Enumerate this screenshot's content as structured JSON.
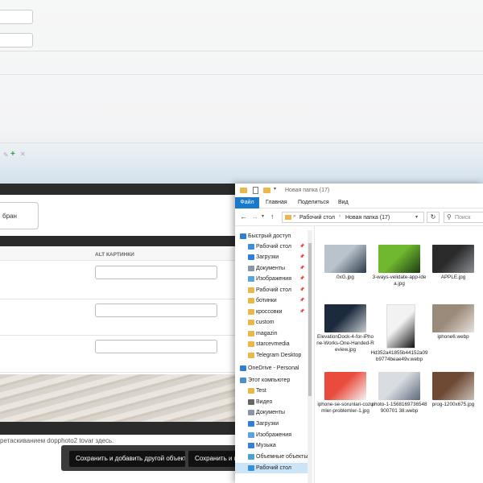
{
  "admin": {
    "choice_tail": "бран",
    "table_header_alt": "ALT КАРТИНКИ",
    "drag_hint": "ретаскиванием dopphoto2 tovar здесь.",
    "save_add_label": "Сохранить и добавить другой объект",
    "save_continue_label": "Сохранить и п",
    "icons": [
      "pencil-icon",
      "plus-icon",
      "close-icon"
    ],
    "colors": {
      "dark_bar": "#2b2b2b",
      "button": "#111111",
      "add_icon": "#2a9d3c"
    }
  },
  "explorer": {
    "title": "Новая папка (17)",
    "ribbon_tabs": [
      "Файл",
      "Главная",
      "Поделиться",
      "Вид"
    ],
    "breadcrumb": [
      "Рабочий стол",
      "Новая папка (17)"
    ],
    "search_placeholder": "Поиск",
    "nav": [
      {
        "label": "Быстрый доступ",
        "icon": "star-icon",
        "pinned": false
      },
      {
        "label": "Рабочий стол",
        "icon": "desktop-icon",
        "pinned": true
      },
      {
        "label": "Загрузки",
        "icon": "download-icon",
        "pinned": true
      },
      {
        "label": "Документы",
        "icon": "documents-icon",
        "pinned": true
      },
      {
        "label": "Изображения",
        "icon": "pictures-icon",
        "pinned": true
      },
      {
        "label": "Рабочий стол",
        "icon": "folder-icon",
        "pinned": true
      },
      {
        "label": "ботинки",
        "icon": "folder-icon",
        "pinned": true
      },
      {
        "label": "кроссовки",
        "icon": "folder-icon",
        "pinned": true
      },
      {
        "label": "custom",
        "icon": "folder-icon",
        "pinned": false
      },
      {
        "label": "magazin",
        "icon": "folder-icon",
        "pinned": false
      },
      {
        "label": "starcevmedia",
        "icon": "folder-icon",
        "pinned": false
      },
      {
        "label": "Telegram Desktop",
        "icon": "folder-icon",
        "pinned": false
      },
      {
        "label": "OneDrive - Personal",
        "icon": "cloud-icon",
        "pinned": false
      },
      {
        "label": "Этот компьютер",
        "icon": "computer-icon",
        "pinned": false
      },
      {
        "label": "Test",
        "icon": "folder-icon",
        "pinned": false
      },
      {
        "label": "Видео",
        "icon": "video-icon",
        "pinned": false
      },
      {
        "label": "Документы",
        "icon": "documents-icon",
        "pinned": false
      },
      {
        "label": "Загрузки",
        "icon": "download-icon",
        "pinned": false
      },
      {
        "label": "Изображения",
        "icon": "pictures-icon",
        "pinned": false
      },
      {
        "label": "Музыка",
        "icon": "music-icon",
        "pinned": false
      },
      {
        "label": "Объемные объекты",
        "icon": "3d-objects-icon",
        "pinned": false
      },
      {
        "label": "Рабочий стол",
        "icon": "desktop-icon",
        "pinned": false
      }
    ],
    "files": [
      {
        "name": "0xG.jpg",
        "colors": [
          "#b9c3cc",
          "#2b3a4a"
        ]
      },
      {
        "name": "3-ways-velidate-app-idea.jpg",
        "colors": [
          "#6fb82f",
          "#1d3a12"
        ]
      },
      {
        "name": "APPLE.jpg",
        "colors": [
          "#2a2a2a",
          "#8a8f94"
        ]
      },
      {
        "name": "ElevationDock-4-for-iPhone-Works-One-Handed-Review.jpg",
        "colors": [
          "#1c2a3d",
          "#c7ccd1"
        ]
      },
      {
        "name": "Hd352a41855b44152a09b9774beae49v.webp",
        "colors": [
          "#f2f2f2",
          "#111111"
        ]
      },
      {
        "name": "iphone6.webp",
        "colors": [
          "#9a8a7a",
          "#e7e2dc"
        ]
      },
      {
        "name": "iphone-se-sorunlari-cozumler-problemler-1.jpg",
        "colors": [
          "#e94c3c",
          "#f5f5f5"
        ]
      },
      {
        "name": "photo-1-1568169736548900701 38.webp",
        "colors": [
          "#d9dde2",
          "#5c6a7a"
        ]
      },
      {
        "name": "prog-1200x675.jpg",
        "colors": [
          "#6e4a34",
          "#c9bfb5"
        ]
      }
    ]
  }
}
